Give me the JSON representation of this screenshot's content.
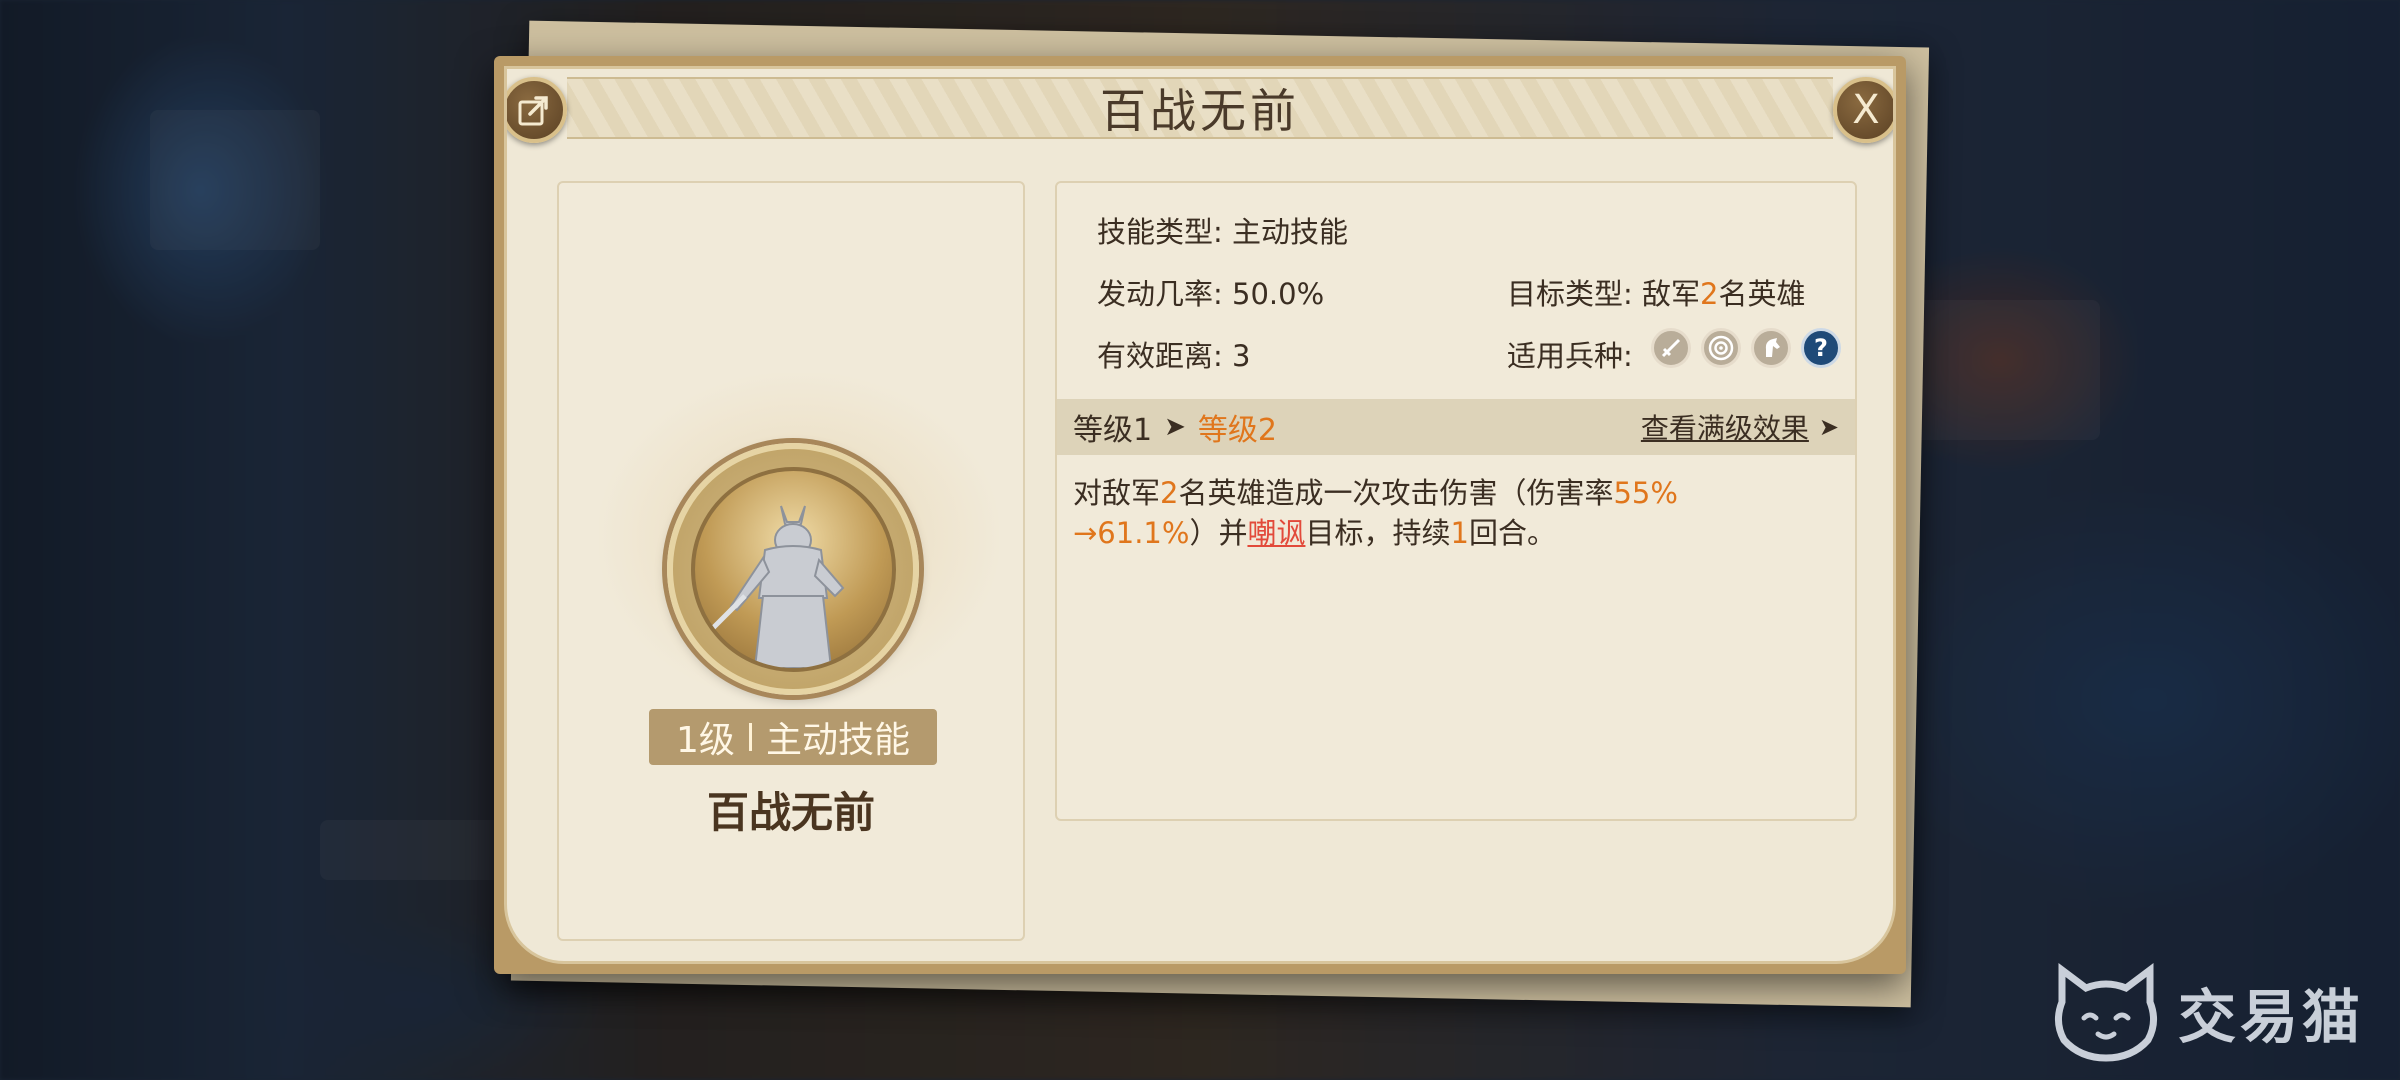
{
  "dialog": {
    "title": "百战无前",
    "close_label": "X"
  },
  "skill": {
    "level_label": "1级",
    "type_badge": "主动技能",
    "name": "百战无前"
  },
  "stats": {
    "skill_type_label": "技能类型:",
    "skill_type_value": "主动技能",
    "trigger_rate_label": "发动几率:",
    "trigger_rate_value": "50.0%",
    "range_label": "有效距离:",
    "range_value": "3",
    "target_label": "目标类型:",
    "target_prefix": "敌军",
    "target_count": "2",
    "target_suffix": "名英雄",
    "troop_label": "适用兵种:",
    "troop_icons": [
      "sword-icon",
      "bow-target-icon",
      "horse-icon",
      "question-icon"
    ],
    "troop_active_symbol": "?"
  },
  "level_bar": {
    "current": "等级1",
    "arrow": "➤",
    "next": "等级2",
    "full_effect_link": "查看满级效果",
    "link_arrow": "➤"
  },
  "description": {
    "p1": "对敌军",
    "count1": "2",
    "p2": "名英雄造成一次攻击伤害（伤害率",
    "rate": "55%",
    "rate_up": "→61.1%",
    "p3": "）并",
    "status": "嘲讽",
    "p4": "目标，持续",
    "turns": "1",
    "p5": "回合。"
  },
  "colors": {
    "highlight_orange": "#e0761c",
    "highlight_red": "#e24a3a",
    "frame_gold": "#b99a66",
    "parchment": "#efe8d6"
  },
  "watermark": {
    "text": "交易猫"
  }
}
